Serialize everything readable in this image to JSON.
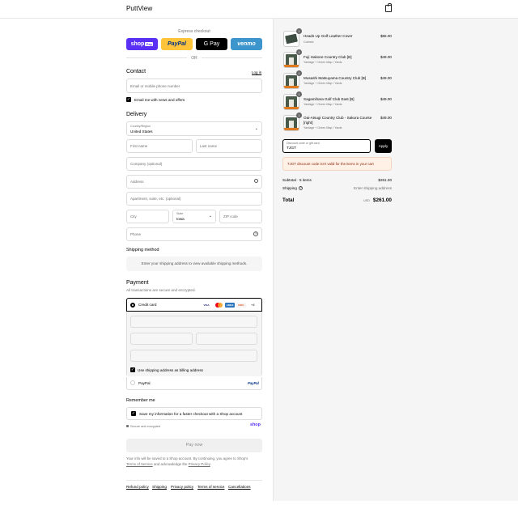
{
  "header": {
    "brand": "PuttView"
  },
  "express": {
    "title": "Express checkout",
    "shop_pay": "shop",
    "shop_pay_badge": "Pay",
    "paypal": "PayPal",
    "gpay": "G Pay",
    "venmo": "venmo",
    "or": "OR"
  },
  "contact": {
    "title": "Contact",
    "login": "Log in",
    "email_placeholder": "Email or mobile phone number",
    "news_label": "Email me with news and offers"
  },
  "delivery": {
    "title": "Delivery",
    "country_label": "Country/Region",
    "country_value": "United States",
    "first_name": "First name",
    "last_name": "Last name",
    "company": "Company (optional)",
    "address": "Address",
    "apartment": "Apartment, suite, etc. (optional)",
    "city": "City",
    "state_label": "State",
    "state_value": "Iowa",
    "zip": "ZIP code",
    "phone": "Phone"
  },
  "shipping_method": {
    "title": "Shipping method",
    "message": "Enter your shipping address to view available shipping methods."
  },
  "payment": {
    "title": "Payment",
    "subtitle": "All transactions are secure and encrypted.",
    "credit_card": "Credit card",
    "card_more": "+4",
    "billing_label": "Use shipping address as billing address",
    "paypal_label": "PayPal",
    "paypal_logo": "PayPal"
  },
  "remember": {
    "title": "Remember me",
    "save_label": "Save my information for a faster checkout with a Shop account",
    "secure": "Secure and encrypted",
    "shop": "shop"
  },
  "pay_button": "Pay now",
  "legal": {
    "line1": "Your info will be saved to a Shop account. By continuing, you agree to Shop's",
    "terms": "Terms of Service",
    "and": "and acknowledge the",
    "privacy": "Privacy Policy",
    "end": "."
  },
  "footer": [
    "Refund policy",
    "Shipping",
    "Privacy policy",
    "Terms of service",
    "Cancellations"
  ],
  "cart": {
    "items": [
      {
        "qty": "1",
        "name": "Heads Up Golf Leather Cover",
        "sub": "Cobra/x",
        "price": "$65.00"
      },
      {
        "qty": "1",
        "name": "Fuji Hakone Country Club [B]",
        "sub": "Yardage + Green Map / Yards",
        "price": "$49.00"
      },
      {
        "qty": "1",
        "name": "Musashi Matsuyama Country Club [B]",
        "sub": "Yardage + Green Map / Yards",
        "price": "$49.00"
      },
      {
        "qty": "1",
        "name": "Sagamihara Golf Club East [B]",
        "sub": "Yardage + Green Map / Yards",
        "price": "$49.00"
      },
      {
        "qty": "1",
        "name": "Oai-Atsugi Country Club - Sakura Course [right]",
        "sub": "Yardage + Green Map / Yards",
        "price": "$49.00"
      }
    ],
    "discount_label": "Discount code or gift card",
    "discount_value": "TJGT",
    "apply": "Apply",
    "error": "TJGT discount code isn't valid for the items in your cart",
    "subtotal_label": "Subtotal · 5 items",
    "subtotal_value": "$261.00",
    "shipping_label": "Shipping",
    "shipping_value": "Enter shipping address",
    "total_label": "Total",
    "currency": "USD",
    "total_value": "$261.00"
  }
}
